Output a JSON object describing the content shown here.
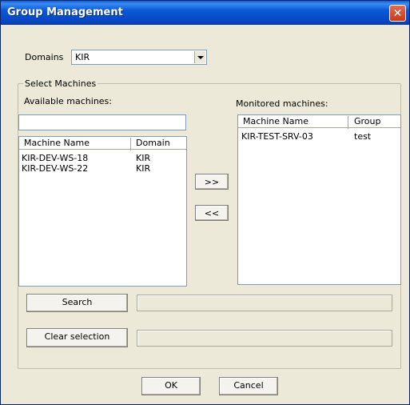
{
  "window": {
    "title": "Group Management",
    "close_symbol": "✕"
  },
  "domains": {
    "label": "Domains",
    "selected": "KIR"
  },
  "select_machines": {
    "title": "Select Machines",
    "available_label": "Available machines:",
    "monitored_label": "Monitored machines:",
    "filter_value": "",
    "available": {
      "columns": [
        "Machine Name",
        "Domain"
      ],
      "rows": [
        {
          "name": "KIR-DEV-WS-18",
          "domain": "KIR"
        },
        {
          "name": "KIR-DEV-WS-22",
          "domain": "KIR"
        }
      ]
    },
    "monitored": {
      "columns": [
        "Machine Name",
        "Group"
      ],
      "rows": [
        {
          "name": "KIR-TEST-SRV-03",
          "group": "test"
        }
      ]
    },
    "add_label": ">>",
    "remove_label": "<<",
    "search_label": "Search",
    "clear_label": "Clear selection"
  },
  "footer": {
    "ok_label": "OK",
    "cancel_label": "Cancel"
  }
}
